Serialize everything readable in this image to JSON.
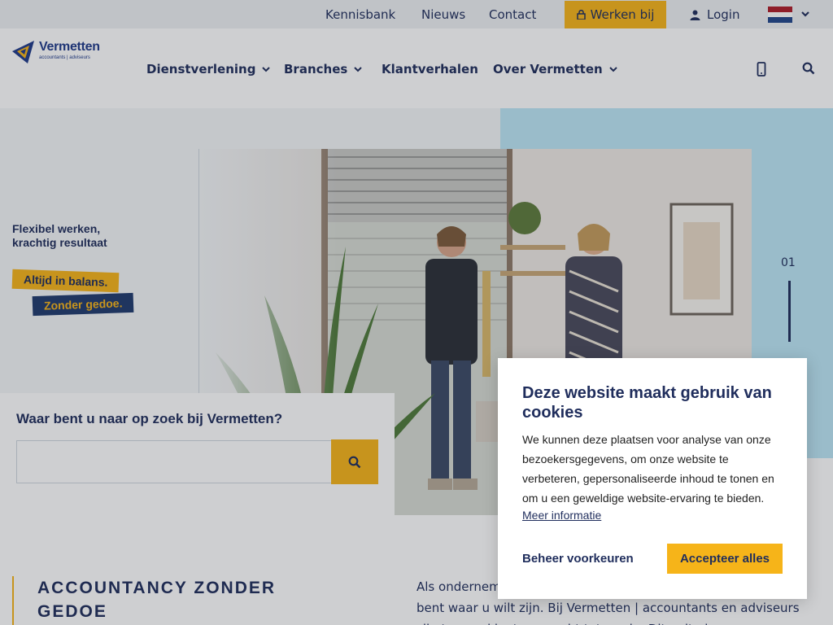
{
  "topbar": {
    "links": [
      "Kennisbank",
      "Nieuws",
      "Contact"
    ],
    "werken_bij": "Werken bij",
    "login": "Login"
  },
  "logo": {
    "name": "Vermetten",
    "tagline": "accountants | adviseurs"
  },
  "nav": {
    "items": [
      "Dienstverlening",
      "Branches",
      "Klantverhalen",
      "Over Vermetten"
    ]
  },
  "hero": {
    "tagline_line1": "Flexibel werken,",
    "tagline_line2": "krachtig resultaat",
    "badge1": "Altijd in balans.",
    "badge2": "Zonder gedoe.",
    "slide_current": "01"
  },
  "search": {
    "heading": "Waar bent u naar op zoek bij Vermetten?",
    "value": "",
    "placeholder": ""
  },
  "content": {
    "title": "ACCOUNTANCY ZONDER GEDOE",
    "line1": "Als ondernemer",
    "line2": "bent waar u wilt zijn. Bij Vermetten | accountants en adviseurs",
    "line3": "zijn trouwe klanten ...recht tot...ard... Dit...alt...kans..."
  },
  "cookie": {
    "title": "Deze website maakt gebruik van cookies",
    "body": "We kunnen deze plaatsen voor analyse van onze bezoekersgegevens, om onze website te verbeteren, gepersonaliseerde inhoud te tonen en om u een geweldige website-ervaring te bieden.",
    "more_link": "Meer informatie",
    "manage_label": "Beheer voorkeuren",
    "accept_label": "Accepteer alles"
  },
  "colors": {
    "accent": "#f6b419",
    "navy": "#1f2d5c",
    "hero_blue": "#bde7f6"
  }
}
